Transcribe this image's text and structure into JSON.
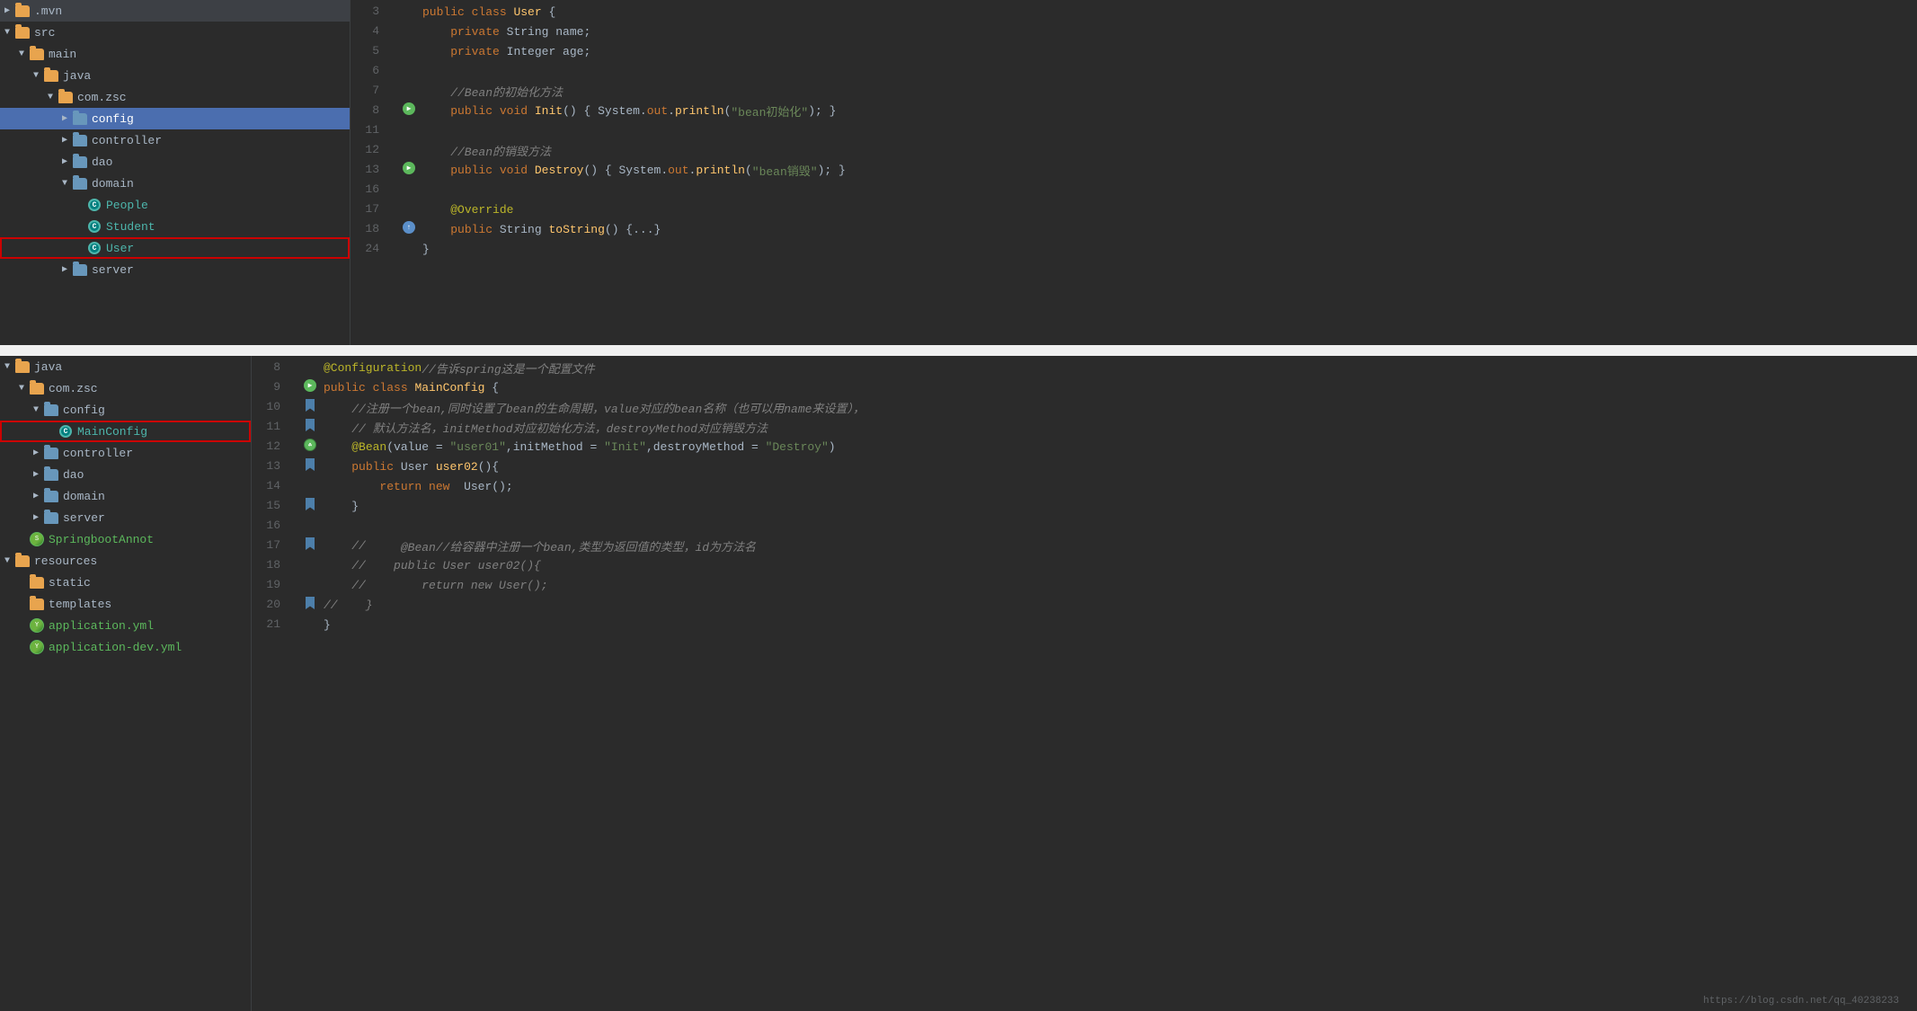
{
  "topPanel": {
    "sidebar": {
      "items": [
        {
          "id": "mvn",
          "label": ".mvn",
          "indent": 0,
          "type": "folder",
          "arrow": "▶",
          "expanded": false
        },
        {
          "id": "src",
          "label": "src",
          "indent": 0,
          "type": "folder",
          "arrow": "▼",
          "expanded": true
        },
        {
          "id": "main",
          "label": "main",
          "indent": 1,
          "type": "folder",
          "arrow": "▼",
          "expanded": true
        },
        {
          "id": "java",
          "label": "java",
          "indent": 2,
          "type": "folder",
          "arrow": "▼",
          "expanded": true
        },
        {
          "id": "com-zsc",
          "label": "com.zsc",
          "indent": 3,
          "type": "folder",
          "arrow": "▼",
          "expanded": true
        },
        {
          "id": "config",
          "label": "config",
          "indent": 4,
          "type": "folder-blue",
          "arrow": "▶",
          "expanded": false,
          "selected": true
        },
        {
          "id": "controller",
          "label": "controller",
          "indent": 4,
          "type": "folder-blue",
          "arrow": "▶",
          "expanded": false
        },
        {
          "id": "dao",
          "label": "dao",
          "indent": 4,
          "type": "folder-blue",
          "arrow": "▶",
          "expanded": false
        },
        {
          "id": "domain",
          "label": "domain",
          "indent": 4,
          "type": "folder-blue",
          "arrow": "▼",
          "expanded": true
        },
        {
          "id": "People",
          "label": "People",
          "indent": 5,
          "type": "class",
          "arrow": ""
        },
        {
          "id": "Student",
          "label": "Student",
          "indent": 5,
          "type": "class",
          "arrow": ""
        },
        {
          "id": "User",
          "label": "User",
          "indent": 5,
          "type": "class",
          "arrow": "",
          "highlighted": true
        },
        {
          "id": "server",
          "label": "server",
          "indent": 4,
          "type": "folder-blue",
          "arrow": "▶",
          "expanded": false
        }
      ]
    },
    "editor": {
      "lines": [
        {
          "num": 3,
          "tokens": [
            {
              "t": "kw",
              "v": "public"
            },
            {
              "t": "plain",
              "v": " "
            },
            {
              "t": "kw",
              "v": "class"
            },
            {
              "t": "plain",
              "v": " "
            },
            {
              "t": "cn-yellow",
              "v": "User"
            },
            {
              "t": "plain",
              "v": " {"
            }
          ],
          "gutter": ""
        },
        {
          "num": 4,
          "tokens": [
            {
              "t": "plain",
              "v": "    "
            },
            {
              "t": "kw",
              "v": "private"
            },
            {
              "t": "plain",
              "v": " "
            },
            {
              "t": "type",
              "v": "String"
            },
            {
              "t": "plain",
              "v": " name;"
            }
          ],
          "gutter": ""
        },
        {
          "num": 5,
          "tokens": [
            {
              "t": "plain",
              "v": "    "
            },
            {
              "t": "kw",
              "v": "private"
            },
            {
              "t": "plain",
              "v": " "
            },
            {
              "t": "type",
              "v": "Integer"
            },
            {
              "t": "plain",
              "v": " age;"
            }
          ],
          "gutter": ""
        },
        {
          "num": 6,
          "tokens": [],
          "gutter": ""
        },
        {
          "num": 7,
          "tokens": [
            {
              "t": "comment",
              "v": "    //Bean的初始化方法"
            }
          ],
          "gutter": ""
        },
        {
          "num": 8,
          "tokens": [
            {
              "t": "plain",
              "v": "    "
            },
            {
              "t": "kw",
              "v": "public"
            },
            {
              "t": "plain",
              "v": " "
            },
            {
              "t": "kw",
              "v": "void"
            },
            {
              "t": "plain",
              "v": " "
            },
            {
              "t": "method",
              "v": "Init"
            },
            {
              "t": "plain",
              "v": "() { "
            },
            {
              "t": "type",
              "v": "System"
            },
            {
              "t": "plain",
              "v": "."
            },
            {
              "t": "out-red",
              "v": "out"
            },
            {
              "t": "plain",
              "v": "."
            },
            {
              "t": "method",
              "v": "println"
            },
            {
              "t": "plain",
              "v": "("
            },
            {
              "t": "string",
              "v": "\"bean初始化\""
            },
            {
              "t": "plain",
              "v": "); }"
            }
          ],
          "gutter": "run"
        },
        {
          "num": 11,
          "tokens": [],
          "gutter": ""
        },
        {
          "num": 12,
          "tokens": [
            {
              "t": "comment",
              "v": "    //Bean的销毁方法"
            }
          ],
          "gutter": ""
        },
        {
          "num": 13,
          "tokens": [
            {
              "t": "plain",
              "v": "    "
            },
            {
              "t": "kw",
              "v": "public"
            },
            {
              "t": "plain",
              "v": " "
            },
            {
              "t": "kw",
              "v": "void"
            },
            {
              "t": "plain",
              "v": " "
            },
            {
              "t": "method",
              "v": "Destroy"
            },
            {
              "t": "plain",
              "v": "() { "
            },
            {
              "t": "type",
              "v": "System"
            },
            {
              "t": "plain",
              "v": "."
            },
            {
              "t": "out-red",
              "v": "out"
            },
            {
              "t": "plain",
              "v": "."
            },
            {
              "t": "method",
              "v": "println"
            },
            {
              "t": "plain",
              "v": "("
            },
            {
              "t": "string",
              "v": "\"bean销毁\""
            },
            {
              "t": "plain",
              "v": "); }"
            }
          ],
          "gutter": "run"
        },
        {
          "num": 16,
          "tokens": [],
          "gutter": ""
        },
        {
          "num": 17,
          "tokens": [
            {
              "t": "plain",
              "v": "    "
            },
            {
              "t": "annotation",
              "v": "@Override"
            }
          ],
          "gutter": ""
        },
        {
          "num": 18,
          "tokens": [
            {
              "t": "plain",
              "v": "    "
            },
            {
              "t": "kw",
              "v": "public"
            },
            {
              "t": "plain",
              "v": " "
            },
            {
              "t": "type",
              "v": "String"
            },
            {
              "t": "plain",
              "v": " "
            },
            {
              "t": "method",
              "v": "toString"
            },
            {
              "t": "plain",
              "v": "() {...}"
            }
          ],
          "gutter": "override"
        },
        {
          "num": 24,
          "tokens": [
            {
              "t": "plain",
              "v": "}"
            }
          ],
          "gutter": ""
        }
      ]
    }
  },
  "bottomPanel": {
    "sidebar": {
      "items": [
        {
          "id": "java-b",
          "label": "java",
          "indent": 0,
          "type": "folder",
          "arrow": "▼",
          "expanded": true
        },
        {
          "id": "com-zsc-b",
          "label": "com.zsc",
          "indent": 1,
          "type": "folder",
          "arrow": "▼",
          "expanded": true
        },
        {
          "id": "config-b",
          "label": "config",
          "indent": 2,
          "type": "folder-blue",
          "arrow": "▼",
          "expanded": true
        },
        {
          "id": "MainConfig",
          "label": "MainConfig",
          "indent": 3,
          "type": "class",
          "arrow": "",
          "highlighted": true
        },
        {
          "id": "controller-b",
          "label": "controller",
          "indent": 2,
          "type": "folder-blue",
          "arrow": "▶",
          "expanded": false
        },
        {
          "id": "dao-b",
          "label": "dao",
          "indent": 2,
          "type": "folder-blue",
          "arrow": "▶",
          "expanded": false
        },
        {
          "id": "domain-b",
          "label": "domain",
          "indent": 2,
          "type": "folder-blue",
          "arrow": "▶",
          "expanded": false
        },
        {
          "id": "server-b",
          "label": "server",
          "indent": 2,
          "type": "folder-blue",
          "arrow": "▶",
          "expanded": false
        },
        {
          "id": "SpringbootAnnot",
          "label": "SpringbootAnnot",
          "indent": 1,
          "type": "springboot",
          "arrow": ""
        },
        {
          "id": "resources",
          "label": "resources",
          "indent": 0,
          "type": "folder",
          "arrow": "▼",
          "expanded": true
        },
        {
          "id": "static",
          "label": "static",
          "indent": 1,
          "type": "folder",
          "arrow": ""
        },
        {
          "id": "templates",
          "label": "templates",
          "indent": 1,
          "type": "folder",
          "arrow": ""
        },
        {
          "id": "application-yml",
          "label": "application.yml",
          "indent": 1,
          "type": "yaml-green",
          "arrow": ""
        },
        {
          "id": "application-dev-yml",
          "label": "application-dev.yml",
          "indent": 1,
          "type": "yaml-green",
          "arrow": ""
        }
      ]
    },
    "editor": {
      "lines": [
        {
          "num": 8,
          "tokens": [
            {
              "t": "annotation",
              "v": "@Configuration"
            },
            {
              "t": "comment",
              "v": "//告诉spring这是一个配置文件"
            }
          ],
          "gutter": ""
        },
        {
          "num": 9,
          "tokens": [
            {
              "t": "kw",
              "v": "public"
            },
            {
              "t": "plain",
              "v": " "
            },
            {
              "t": "kw",
              "v": "class"
            },
            {
              "t": "plain",
              "v": " "
            },
            {
              "t": "cn-yellow",
              "v": "MainConfig"
            },
            {
              "t": "plain",
              "v": " {"
            }
          ],
          "gutter": "run"
        },
        {
          "num": 10,
          "tokens": [
            {
              "t": "plain",
              "v": "    "
            },
            {
              "t": "comment",
              "v": "//注册一个bean,同时设置了bean的生命周期，value对应的bean名称（也可以用name来设置），"
            }
          ],
          "gutter": "bookmark"
        },
        {
          "num": 11,
          "tokens": [
            {
              "t": "plain",
              "v": "    "
            },
            {
              "t": "comment",
              "v": "// 默认方法名，initMethod对应初始化方法，destroyMethod对应销毁方法"
            }
          ],
          "gutter": "bookmark"
        },
        {
          "num": 12,
          "tokens": [
            {
              "t": "plain",
              "v": "    "
            },
            {
              "t": "annotation",
              "v": "@Bean"
            },
            {
              "t": "plain",
              "v": "("
            },
            {
              "t": "plain",
              "v": "value = "
            },
            {
              "t": "string",
              "v": "\"user01\""
            },
            {
              "t": "plain",
              "v": ","
            },
            {
              "t": "plain",
              "v": "initMethod = "
            },
            {
              "t": "string",
              "v": "\"Init\""
            },
            {
              "t": "plain",
              "v": ","
            },
            {
              "t": "plain",
              "v": "destroyMethod = "
            },
            {
              "t": "string",
              "v": "\"Destroy\""
            },
            {
              "t": "plain",
              "v": ")"
            }
          ],
          "gutter": "bean"
        },
        {
          "num": 13,
          "tokens": [
            {
              "t": "plain",
              "v": "    "
            },
            {
              "t": "kw",
              "v": "public"
            },
            {
              "t": "plain",
              "v": " "
            },
            {
              "t": "type",
              "v": "User"
            },
            {
              "t": "plain",
              "v": " "
            },
            {
              "t": "method",
              "v": "user02"
            },
            {
              "t": "plain",
              "v": "(){"
            }
          ],
          "gutter": "bookmark"
        },
        {
          "num": 14,
          "tokens": [
            {
              "t": "plain",
              "v": "        "
            },
            {
              "t": "kw",
              "v": "return"
            },
            {
              "t": "plain",
              "v": " "
            },
            {
              "t": "kw",
              "v": "new"
            },
            {
              "t": "plain",
              "v": "  "
            },
            {
              "t": "type",
              "v": "User"
            },
            {
              "t": "plain",
              "v": "();"
            }
          ],
          "gutter": ""
        },
        {
          "num": 15,
          "tokens": [
            {
              "t": "plain",
              "v": "    }"
            }
          ],
          "gutter": "bookmark"
        },
        {
          "num": 16,
          "tokens": [],
          "gutter": ""
        },
        {
          "num": 17,
          "tokens": [
            {
              "t": "plain",
              "v": "    "
            },
            {
              "t": "comment",
              "v": "// "
            },
            {
              "t": "plain",
              "v": "    "
            },
            {
              "t": "comment",
              "v": "@Bean//给容器中注册一个bean,类型为返回值的类型，id为方法名"
            }
          ],
          "gutter": "bookmark"
        },
        {
          "num": 18,
          "tokens": [
            {
              "t": "plain",
              "v": "    "
            },
            {
              "t": "comment",
              "v": "//    public User user02(){"
            }
          ],
          "gutter": ""
        },
        {
          "num": 19,
          "tokens": [
            {
              "t": "plain",
              "v": "    "
            },
            {
              "t": "comment",
              "v": "//        return new User();"
            }
          ],
          "gutter": ""
        },
        {
          "num": 20,
          "tokens": [
            {
              "t": "comment",
              "v": "//    }"
            }
          ],
          "gutter": "bookmark"
        },
        {
          "num": 21,
          "tokens": [
            {
              "t": "plain",
              "v": "}"
            }
          ],
          "gutter": ""
        }
      ]
    }
  },
  "urlBar": "https://blog.csdn.net/qq_40238233"
}
